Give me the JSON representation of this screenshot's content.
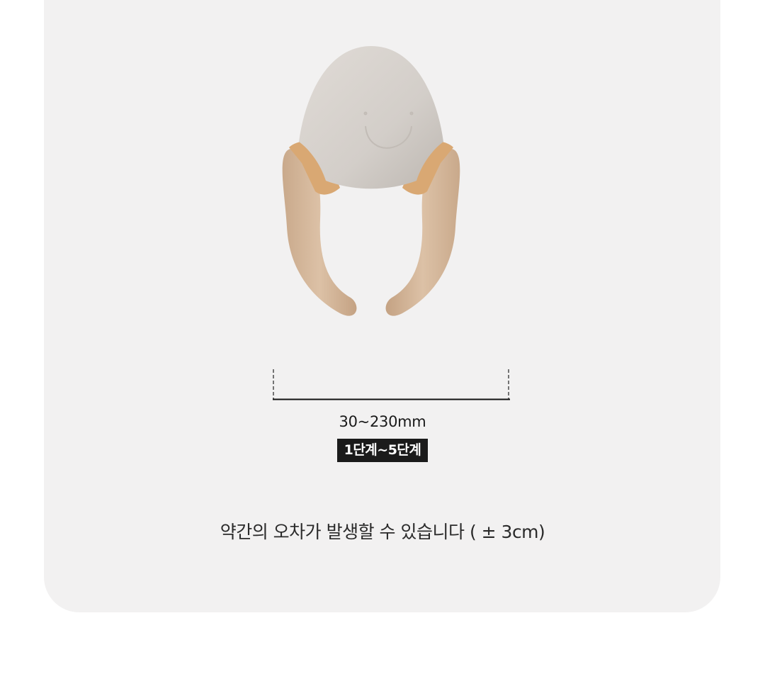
{
  "product": {
    "icon": "smile-icon"
  },
  "measurement": {
    "range_text": "30~230mm",
    "level_text": "1단계~5단계"
  },
  "note": {
    "text": "약간의 오차가 발생할 수 있습니다 ( ± 3cm)"
  },
  "colors": {
    "card_background": "#f2f1f1",
    "badge_background": "#1b1b1b",
    "product_body": "#d6d1cc",
    "product_arms": "#d4b79a",
    "product_band": "#d9a873"
  }
}
